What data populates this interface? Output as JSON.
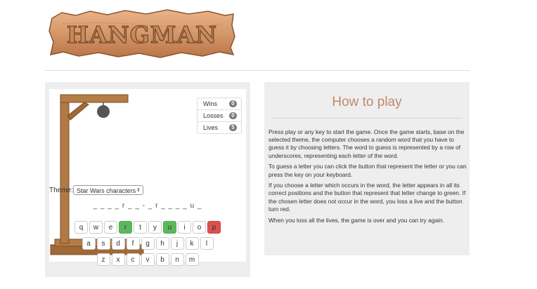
{
  "header": {
    "logo_text": "HANGMAN"
  },
  "stats": [
    {
      "label": "Wins",
      "value": "0"
    },
    {
      "label": "Losses",
      "value": "0"
    },
    {
      "label": "Lives",
      "value": "5"
    }
  ],
  "theme": {
    "label": "Theme:",
    "selected": "Star Wars characters"
  },
  "word": "_ _ _ _ r _ _ - _ r _ _ _ _ u _",
  "keyboard": {
    "row1": [
      "q",
      "w",
      "e",
      "r",
      "t",
      "y",
      "u",
      "i",
      "o",
      "p"
    ],
    "row2": [
      "a",
      "s",
      "d",
      "f",
      "g",
      "h",
      "j",
      "k",
      "l"
    ],
    "row3": [
      "z",
      "x",
      "c",
      "v",
      "b",
      "n",
      "m"
    ],
    "correct_letters": [
      "r",
      "u"
    ],
    "wrong_letters": [
      "p"
    ],
    "correct_color": "#5cb85c",
    "wrong_color": "#d9534f"
  },
  "howto": {
    "title": "How to play",
    "paragraphs": [
      "Press play or any key to start the game. Once the game starts, base on the selected theme, the computer chooses a random word that you have to guess it by choosing letters. The word to guess is represented by a row of underscores, representing each letter of the word.",
      "To guess a letter you can click the button that represent the letter or you can press the key on your keyboard.",
      "If you choose a letter which occurs in the word, the letter appears in all its correct positions and the button that represent that letter change to green. If the chosen letter does not occur in the word, you loss a live and the button turn red.",
      "When you loss all the lives, the game is over and you can try again."
    ]
  },
  "colors": {
    "accent": "#c0896a",
    "wood": "#b07a45",
    "panel": "#eeeeee"
  }
}
